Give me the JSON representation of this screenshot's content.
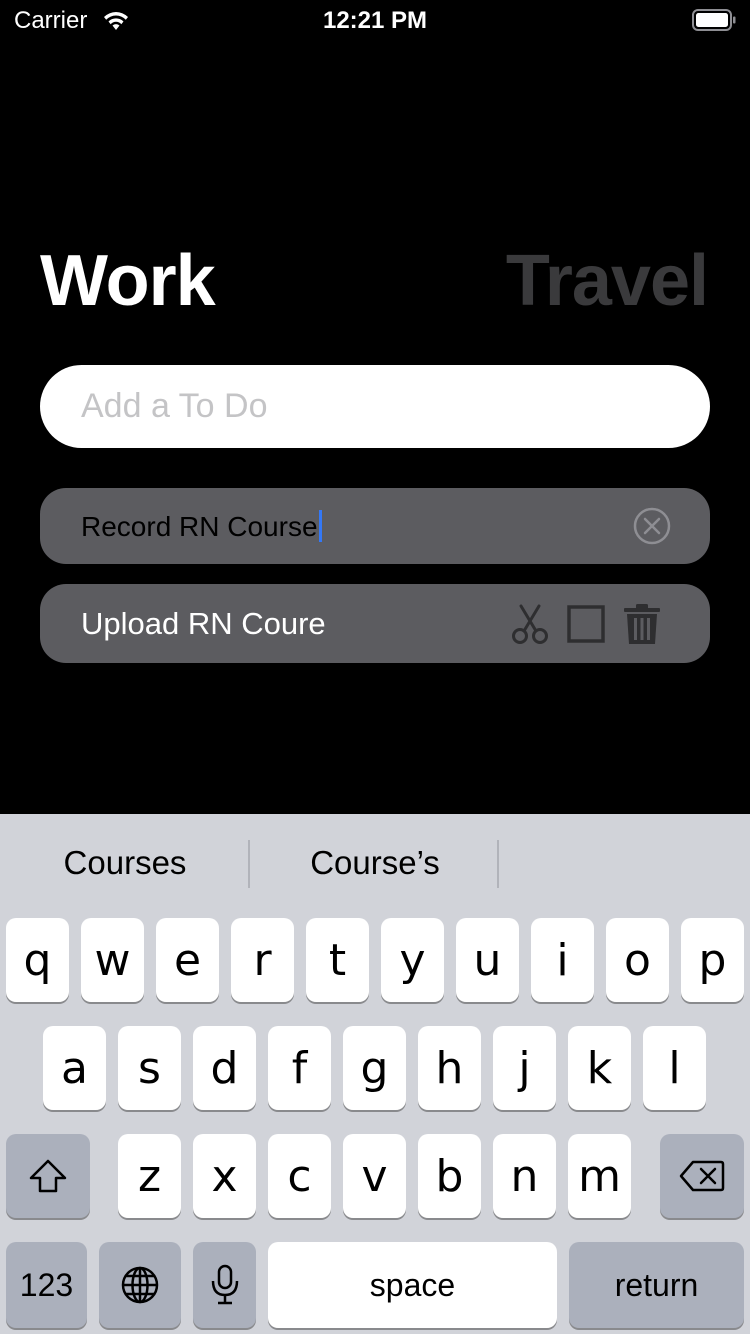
{
  "status_bar": {
    "carrier": "Carrier",
    "time": "12:21 PM"
  },
  "tabs": {
    "work": "Work",
    "travel": "Travel",
    "active": "Work"
  },
  "add_input": {
    "placeholder": "Add a To Do",
    "value": ""
  },
  "todos": [
    {
      "text": "Record RN Course",
      "editing": true,
      "done": false
    },
    {
      "text": "Upload RN Coure",
      "editing": false,
      "done": false
    }
  ],
  "keyboard": {
    "suggestions": [
      "Courses",
      "Course’s",
      ""
    ],
    "row1": [
      "q",
      "w",
      "e",
      "r",
      "t",
      "y",
      "u",
      "i",
      "o",
      "p"
    ],
    "row2": [
      "a",
      "s",
      "d",
      "f",
      "g",
      "h",
      "j",
      "k",
      "l"
    ],
    "row3": [
      "z",
      "x",
      "c",
      "v",
      "b",
      "n",
      "m"
    ],
    "numbers_key": "123",
    "space_key": "space",
    "return_key": "return"
  },
  "colors": {
    "background": "#000000",
    "card": "#5c5c60",
    "inactive_tab": "#3a3a3c",
    "caret": "#3478f6",
    "keyboard": "#d1d3d9"
  }
}
